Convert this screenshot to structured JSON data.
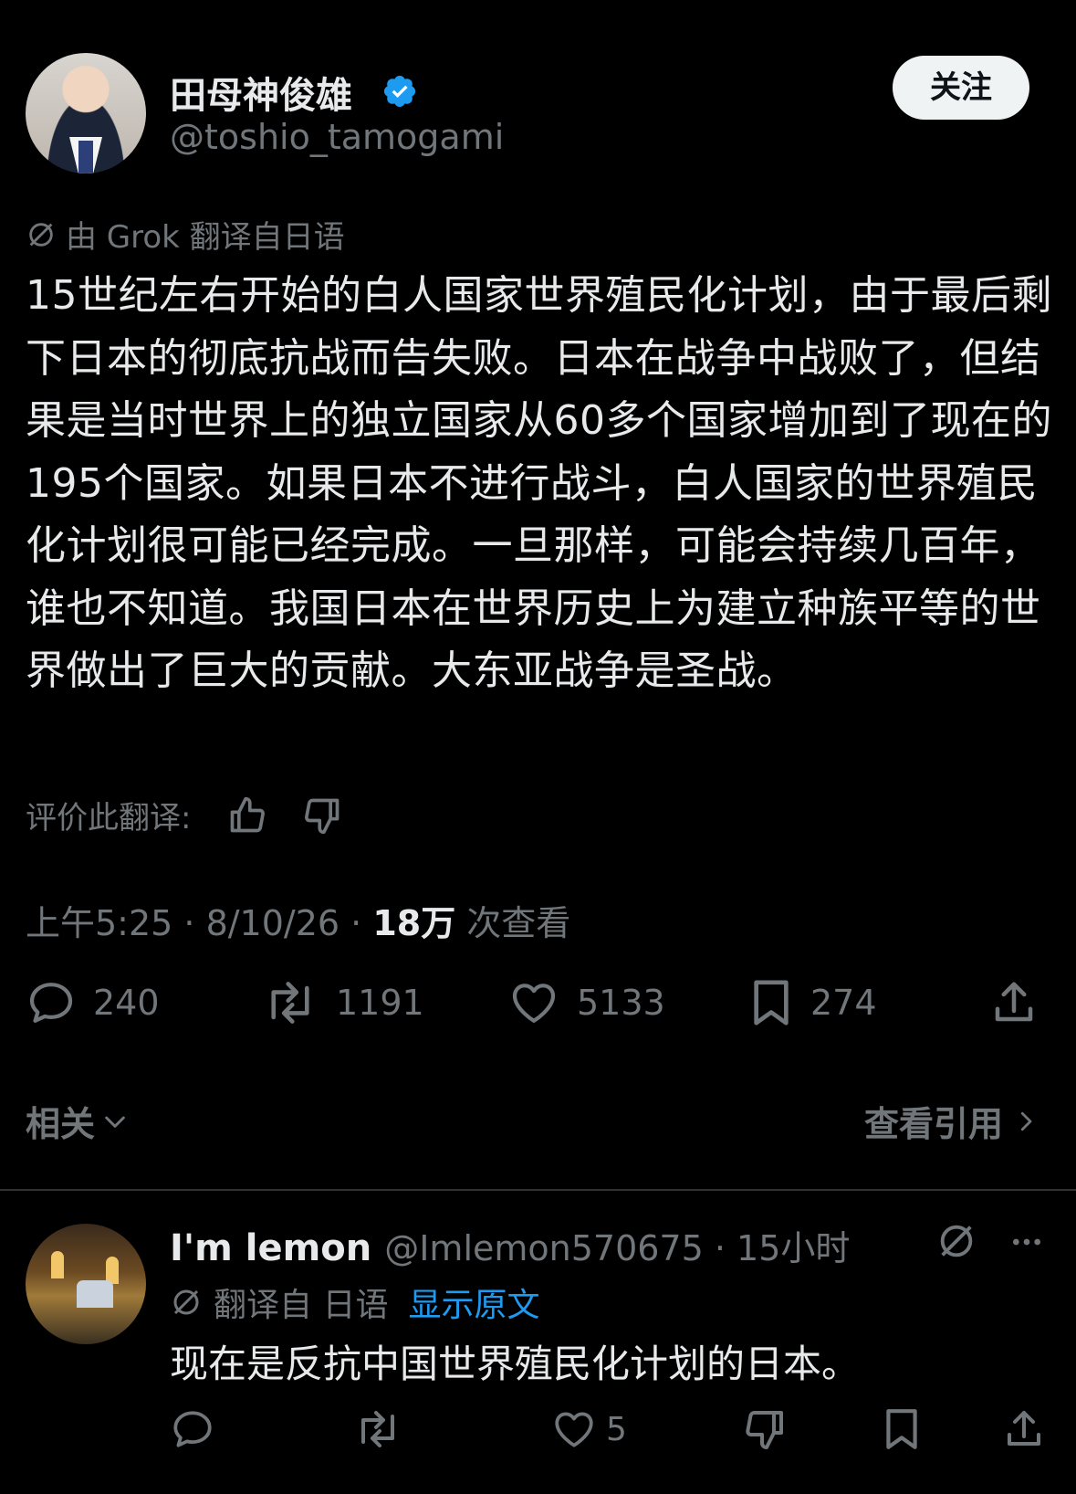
{
  "author": {
    "name": "田母神俊雄",
    "handle": "@toshio_tamogami",
    "follow_label": "关注"
  },
  "translation": {
    "label": "由 Grok 翻译自日语",
    "rate_label": "评价此翻译:"
  },
  "post": {
    "text": "15世纪左右开始的白人国家世界殖民化计划，由于最后剩下日本的彻底抗战而告失败。日本在战争中战败了，但结果是当时世界上的独立国家从60多个国家增加到了现在的195个国家。如果日本不进行战斗，白人国家的世界殖民化计划很可能已经完成。一旦那样，可能会持续几百年，谁也不知道。我国日本在世界历史上为建立种族平等的世界做出了巨大的贡献。大东亚战争是圣战。",
    "time": "上午5:25 · 8/10/26 · ",
    "views_count": "18万",
    "views_label": " 次查看"
  },
  "stats": {
    "replies": "240",
    "reposts": "1191",
    "likes": "5133",
    "bookmarks": "274"
  },
  "related_label": "相关",
  "quotes_label": "查看引用",
  "reply": {
    "name": "I'm lemon",
    "meta": "@Imlemon570675 · 15小时",
    "translated_label": "翻译自 日语",
    "show_original": "显示原文",
    "text": "现在是反抗中国世界殖民化计划的日本。",
    "likes": "5"
  },
  "colors": {
    "background": "#000000",
    "text": "#e7e9ea",
    "muted": "#71767b",
    "accent": "#1d9bf0"
  }
}
